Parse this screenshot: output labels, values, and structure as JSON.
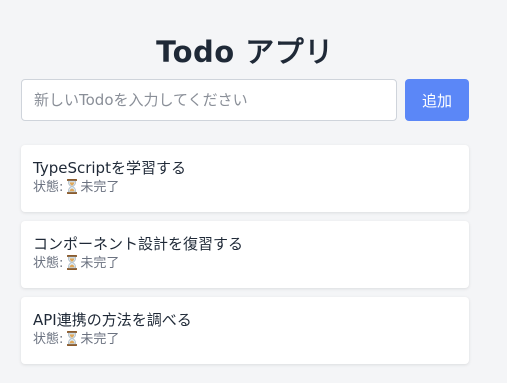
{
  "app": {
    "title": "Todo アプリ"
  },
  "form": {
    "input_placeholder": "新しいTodoを入力してください",
    "input_value": "",
    "add_label": "追加"
  },
  "todos": [
    {
      "title": "TypeScriptを学習する",
      "status_prefix": "状態:",
      "status_icon": "hourglass-icon",
      "status_label": "未完了"
    },
    {
      "title": "コンポーネント設計を復習する",
      "status_prefix": "状態:",
      "status_icon": "hourglass-icon",
      "status_label": "未完了"
    },
    {
      "title": "API連携の方法を調べる",
      "status_prefix": "状態:",
      "status_icon": "hourglass-icon",
      "status_label": "未完了"
    }
  ],
  "colors": {
    "background": "#f4f5f7",
    "accent": "#5b87f7",
    "card": "#ffffff",
    "text": "#1f2937",
    "muted_text": "#6b7280"
  }
}
